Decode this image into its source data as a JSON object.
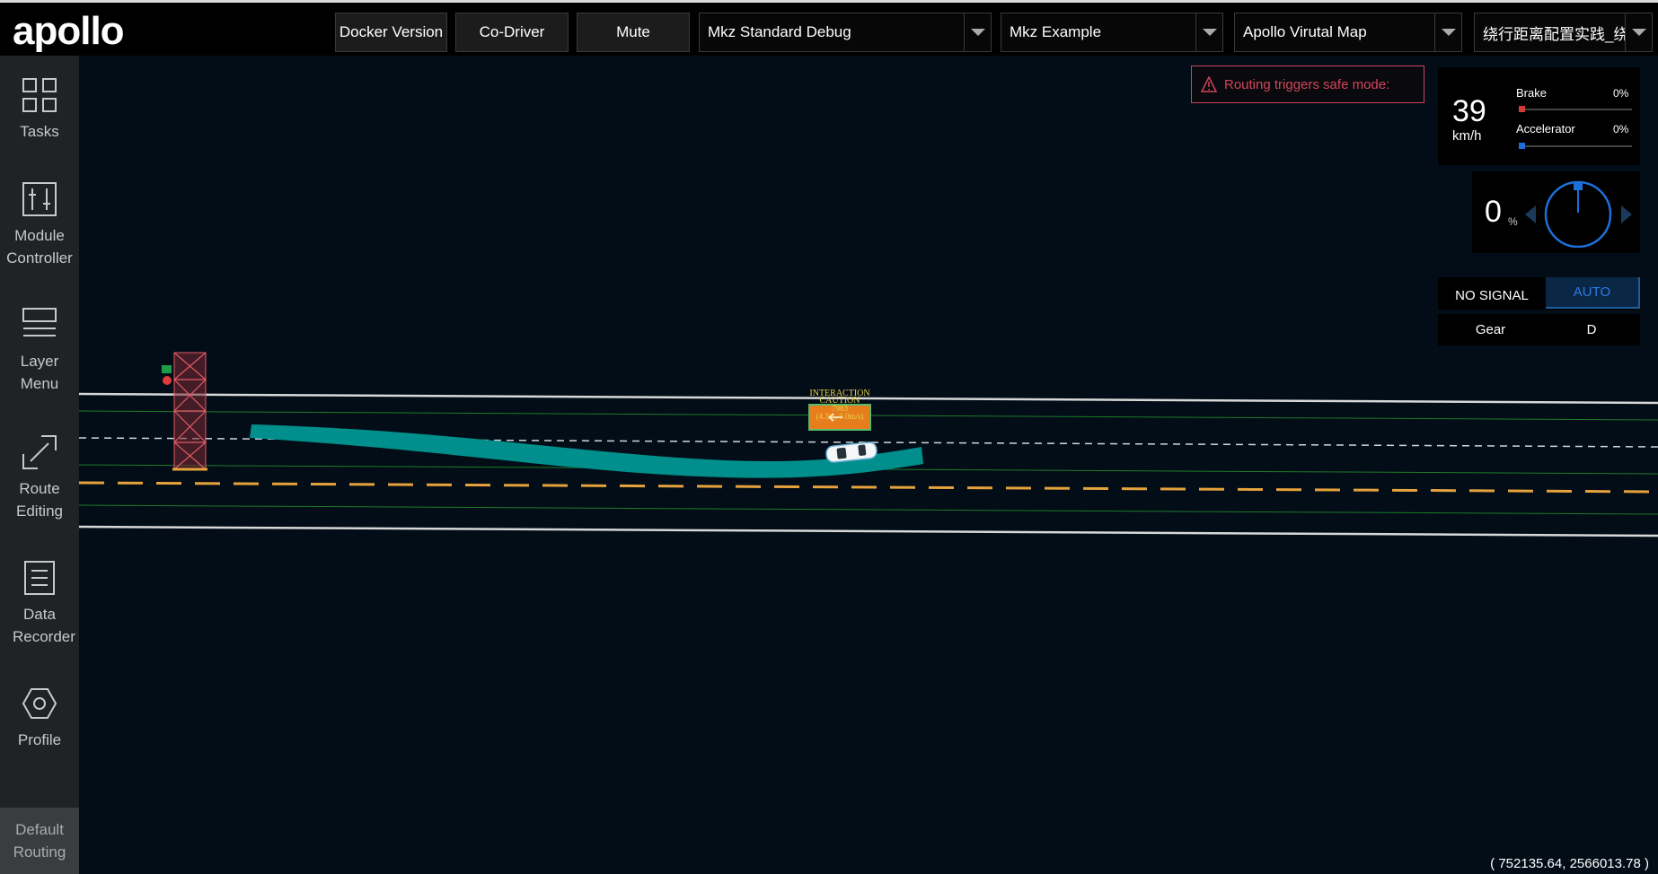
{
  "app": {
    "logo": "apollo"
  },
  "header": {
    "docker_button": "Docker Version",
    "codriver_button": "Co-Driver",
    "mute_button": "Mute",
    "mode_select": "Mkz Standard Debug",
    "vehicle_select": "Mkz Example",
    "map_select": "Apollo Virutal Map",
    "scenario_select": "绕行距离配置实践_绕行"
  },
  "sidebar": {
    "items": [
      {
        "label": "Tasks",
        "icon": "grid-icon"
      },
      {
        "label": "Module Controller",
        "icon": "sliders-icon"
      },
      {
        "label": "Layer Menu",
        "icon": "layers-icon"
      },
      {
        "label": "Route Editing",
        "icon": "route-icon"
      },
      {
        "label": "Data Recorder",
        "icon": "document-icon"
      },
      {
        "label": "Profile",
        "icon": "hexagon-icon"
      }
    ],
    "bottom": "Default Routing"
  },
  "notification": {
    "text": "Routing triggers safe mode:",
    "color": "#d0455b"
  },
  "dashboard": {
    "speed": "39",
    "speed_unit": "km/h",
    "brake_label": "Brake",
    "brake_value": "0%",
    "brake_color": "#d33b3b",
    "accelerator_label": "Accelerator",
    "accelerator_value": "0%",
    "accelerator_color": "#1e6fd9",
    "steering_value": "0",
    "steering_unit": "%",
    "signal": "NO SIGNAL",
    "drive_mode": "AUTO",
    "gear_label": "Gear",
    "gear_value": "D"
  },
  "scene": {
    "obstacle_labels": [
      "INTERACTION",
      "CAUTION",
      "7983",
      "(4.3m, 0.0m/s)"
    ],
    "planning_color": "#008f8c",
    "lane_color": "#e6a23c"
  },
  "coordinates": "( 752135.64, 2566013.78 )"
}
